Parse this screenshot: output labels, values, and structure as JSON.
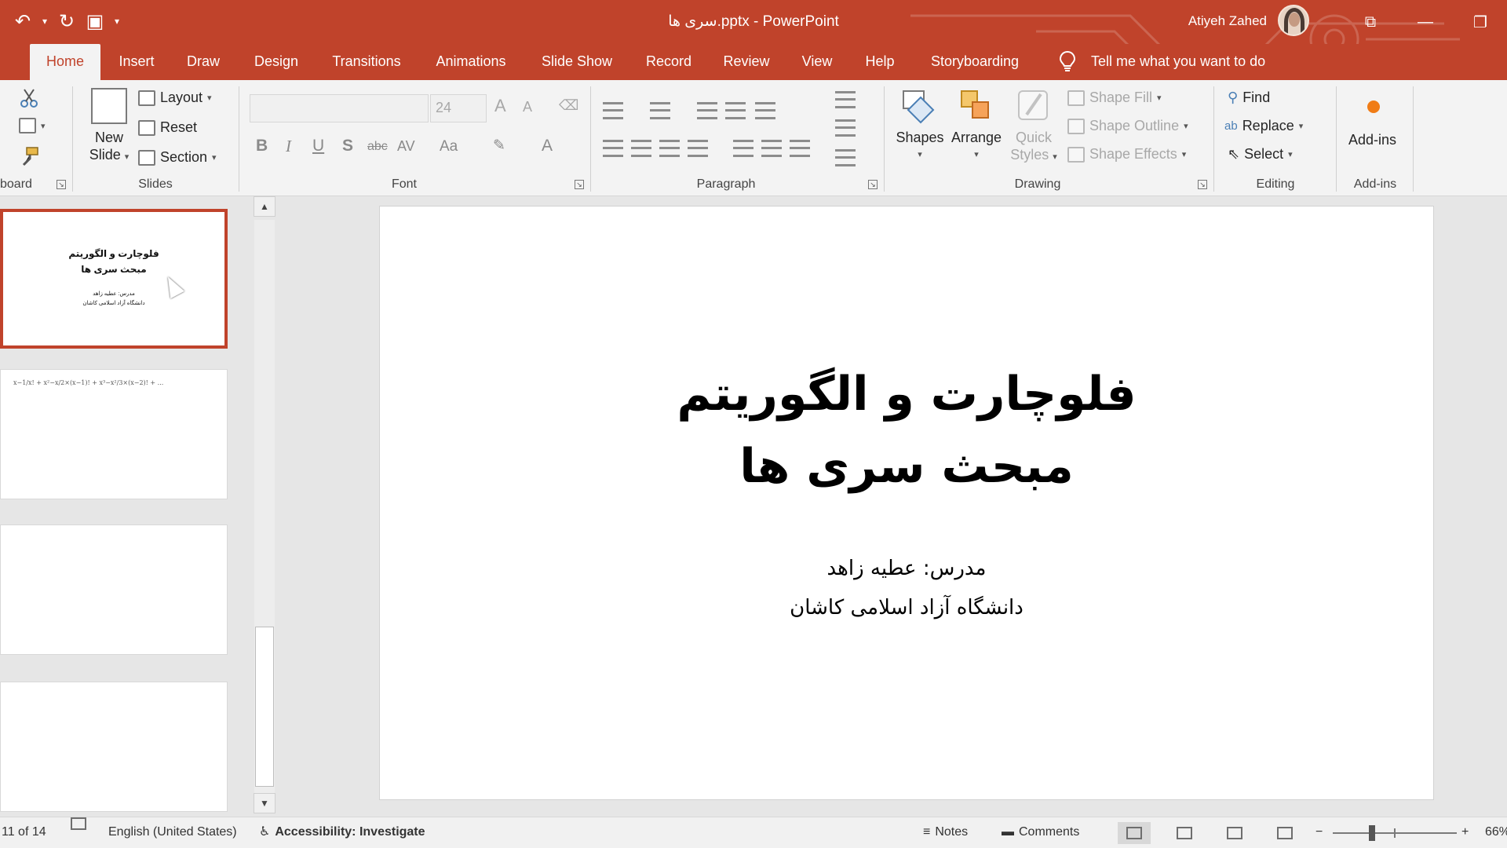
{
  "window": {
    "title": "سری ها.pptx  -  PowerPoint",
    "user_name": "Atiyeh Zahed",
    "qat": {
      "undo_glyph": "↶",
      "dropdown_glyph": "▾",
      "redo_glyph": "↻",
      "present_glyph": "▣",
      "customize_glyph": "▾"
    },
    "controls": {
      "ribbon_display": "⧉",
      "minimize": "—",
      "restore": "❐"
    }
  },
  "tabs": [
    {
      "label": "Home",
      "active": true
    },
    {
      "label": "Insert"
    },
    {
      "label": "Draw"
    },
    {
      "label": "Design"
    },
    {
      "label": "Transitions"
    },
    {
      "label": "Animations"
    },
    {
      "label": "Slide Show"
    },
    {
      "label": "Record"
    },
    {
      "label": "Review"
    },
    {
      "label": "View"
    },
    {
      "label": "Help"
    },
    {
      "label": "Storyboarding"
    }
  ],
  "tell_me": "Tell me what you want to do",
  "ribbon": {
    "clipboard": {
      "label": "board"
    },
    "slides": {
      "label": "Slides",
      "new_slide_line1": "New",
      "new_slide_line2": "Slide",
      "layout": "Layout",
      "reset": "Reset",
      "section": "Section"
    },
    "font": {
      "label": "Font",
      "size": "24",
      "bold": "B",
      "italic": "I",
      "underline": "U",
      "shadow": "S",
      "strike": "abc",
      "spacing": "AV",
      "case": "Aa",
      "grow": "A",
      "shrink": "A",
      "color": "A"
    },
    "paragraph": {
      "label": "Paragraph"
    },
    "drawing": {
      "label": "Drawing",
      "shapes": "Shapes",
      "arrange": "Arrange",
      "quick_line1": "Quick",
      "quick_line2": "Styles",
      "shape_fill": "Shape Fill",
      "shape_outline": "Shape Outline",
      "shape_effects": "Shape Effects"
    },
    "editing": {
      "label": "Editing",
      "find": "Find",
      "replace": "Replace",
      "select": "Select"
    },
    "addins": {
      "label": "Add-ins",
      "button": "Add-ins"
    }
  },
  "thumbnails": [
    {
      "title1": "فلوچارت و الگوریتم",
      "title2": "مبحث سری ها",
      "sub1": "مدرس: عطیه زاهد",
      "sub2": "دانشگاه آزاد اسلامی کاشان",
      "selected": true
    },
    {
      "formula": "x−1/x! + x²−x/2×(x−1)! + x³−x²/3×(x−2)! + ..."
    },
    {},
    {}
  ],
  "scroll": {
    "up": "▲",
    "down": "▼"
  },
  "slide": {
    "title_line1": "فلوچارت و الگوریتم",
    "title_line2": "مبحث سری ها",
    "subtitle_line1": "مدرس: عطیه زاهد",
    "subtitle_line2": "دانشگاه آزاد اسلامی کاشان"
  },
  "status": {
    "slide_count": "11 of 14",
    "language": "English (United States)",
    "accessibility": "Accessibility: Investigate",
    "notes": "Notes",
    "comments": "Comments",
    "zoom_minus": "−",
    "zoom_plus": "+",
    "zoom": "66%"
  },
  "colors": {
    "accent": "#c0432b",
    "addin_dot": "#f07c16"
  }
}
